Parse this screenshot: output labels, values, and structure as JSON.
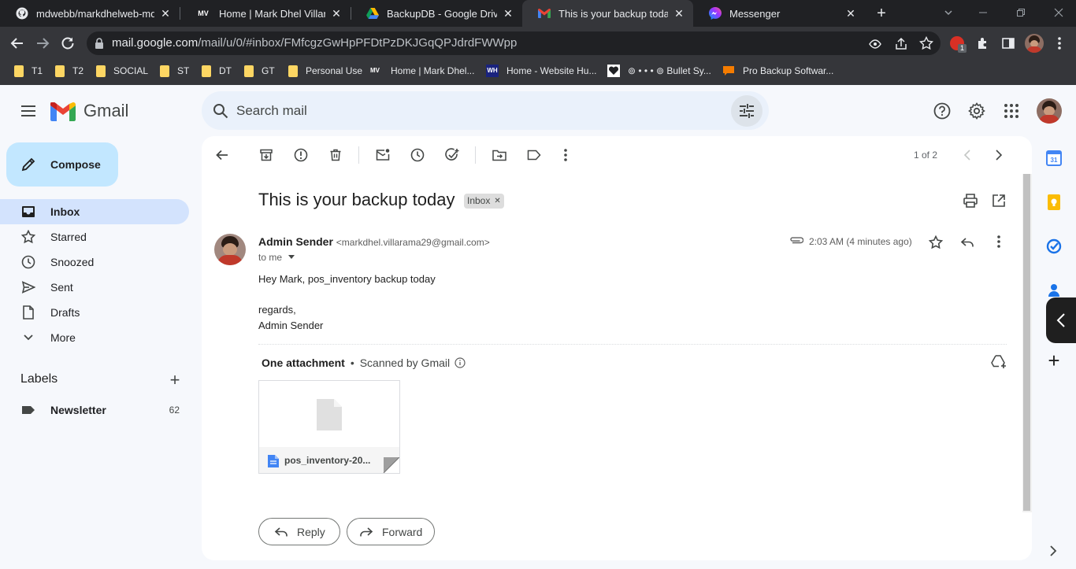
{
  "browser": {
    "tabs": [
      {
        "title": "mdwebb/markdhelweb-md",
        "icon": "github-icon"
      },
      {
        "title": "Home | Mark Dhel Villarama",
        "icon": "mv-logo-icon"
      },
      {
        "title": "BackupDB - Google Drive",
        "icon": "google-drive-icon"
      },
      {
        "title": "This is your backup today - ",
        "icon": "gmail-icon"
      },
      {
        "title": "Messenger",
        "icon": "messenger-icon"
      }
    ],
    "url_host": "mail.google.com",
    "url_path": "/mail/u/0/#inbox/FMfcgzGwHpPFDtPzDKJGqQPJdrdFWWpp",
    "extension_badge": "1",
    "bookmarks": [
      {
        "label": "T1",
        "icon": "folder-icon"
      },
      {
        "label": "T2",
        "icon": "folder-icon"
      },
      {
        "label": "SOCIAL",
        "icon": "folder-icon"
      },
      {
        "label": "ST",
        "icon": "folder-icon"
      },
      {
        "label": "DT",
        "icon": "folder-icon"
      },
      {
        "label": "GT",
        "icon": "folder-icon"
      },
      {
        "label": "Personal Use",
        "icon": "folder-icon"
      },
      {
        "label": "Home | Mark Dhel...",
        "icon": "mv-logo-icon"
      },
      {
        "label": "Home - Website Hu...",
        "icon": "wh-logo-icon"
      },
      {
        "label": "⊚ • • • ⊚ Bullet Sy...",
        "icon": "heart-icon"
      },
      {
        "label": "Pro Backup Softwar...",
        "icon": "chat-bubble-icon"
      }
    ]
  },
  "gmail": {
    "logo_text": "Gmail",
    "search_placeholder": "Search mail",
    "compose_label": "Compose",
    "nav": [
      {
        "label": "Inbox",
        "icon": "inbox-icon",
        "active": true
      },
      {
        "label": "Starred",
        "icon": "star-icon"
      },
      {
        "label": "Snoozed",
        "icon": "clock-icon"
      },
      {
        "label": "Sent",
        "icon": "send-icon"
      },
      {
        "label": "Drafts",
        "icon": "draft-icon"
      },
      {
        "label": "More",
        "icon": "chevron-down-icon"
      }
    ],
    "labels_heading": "Labels",
    "labels": [
      {
        "label": "Newsletter",
        "count": "62",
        "icon": "label-icon"
      }
    ],
    "pagination": "1 of 2"
  },
  "email": {
    "subject": "This is your backup today",
    "label_chip": "Inbox",
    "sender_name": "Admin Sender",
    "sender_email": "<markdhel.villarama29@gmail.com>",
    "time": "2:03 AM (4 minutes ago)",
    "to": "to me",
    "body_line1": "Hey Mark, pos_inventory backup today",
    "body_line2": "regards,",
    "body_line3": "Admin Sender",
    "attachment_heading": "One attachment",
    "scanned_text": "Scanned by Gmail",
    "attachment_name": "pos_inventory-20...",
    "reply_label": "Reply",
    "forward_label": "Forward"
  },
  "colors": {
    "gmail_red": "#ea4335",
    "compose_bg": "#c2e7ff",
    "active_nav": "#d3e3fd",
    "search_bg": "#eaf1fb"
  }
}
